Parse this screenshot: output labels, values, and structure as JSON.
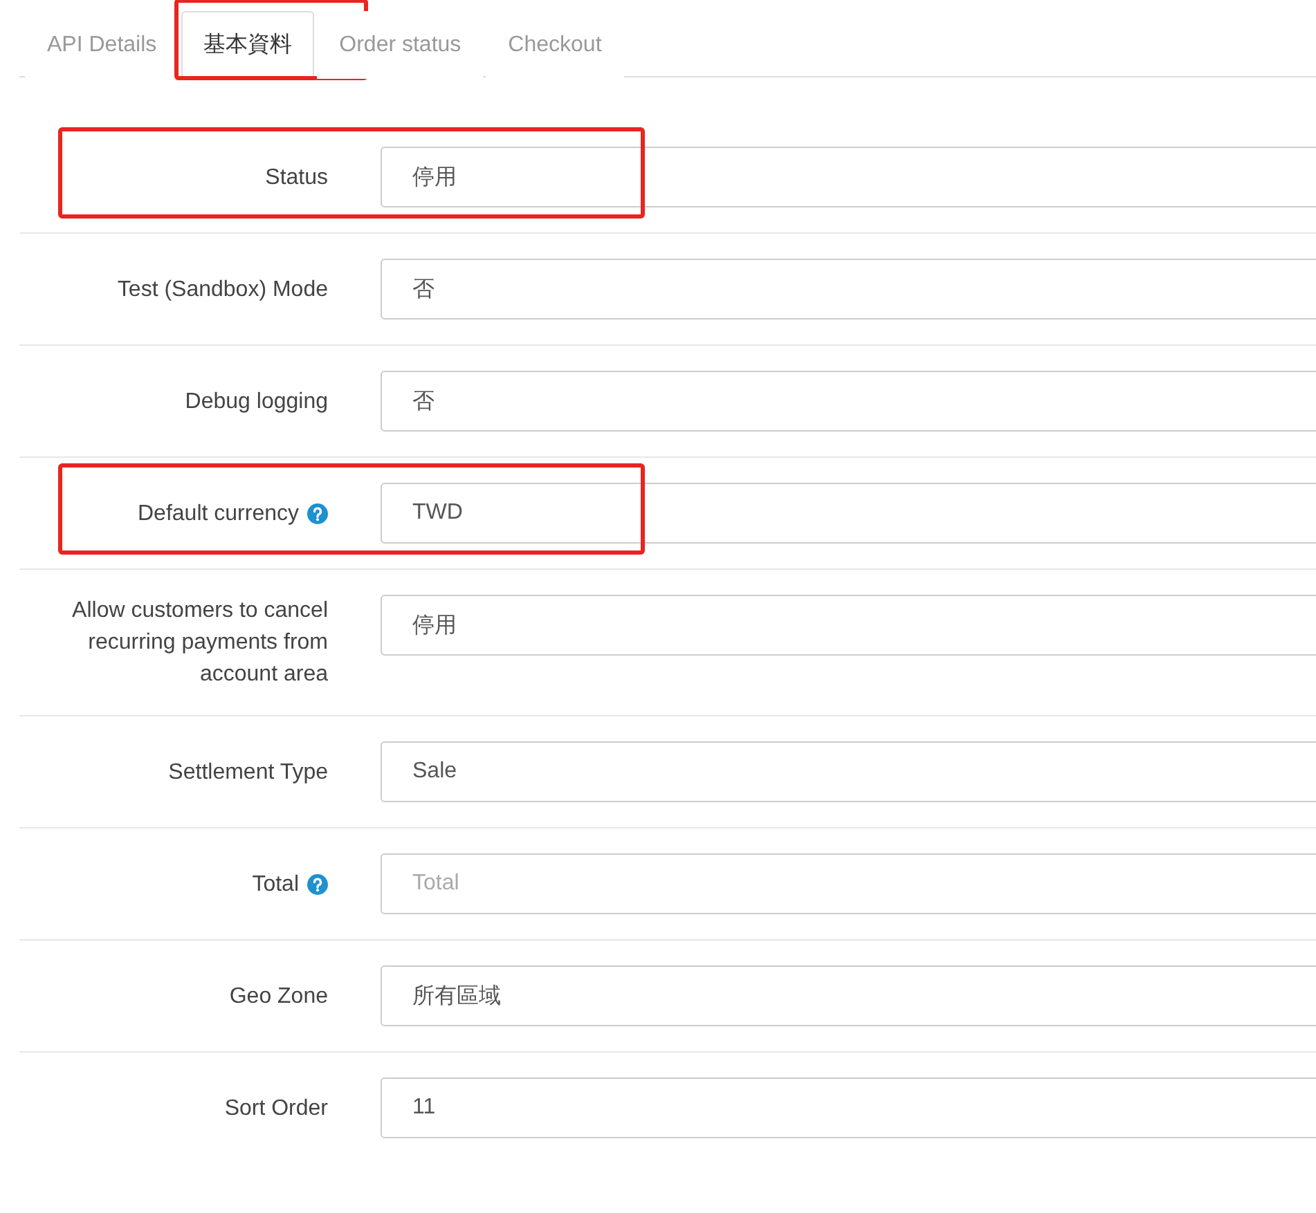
{
  "tabs": [
    {
      "label": "API Details",
      "selected": false,
      "highlighted": false
    },
    {
      "label": "基本資料",
      "selected": true,
      "highlighted": true
    },
    {
      "label": "Order status",
      "selected": false,
      "highlighted": false
    },
    {
      "label": "Checkout",
      "selected": false,
      "highlighted": false
    }
  ],
  "fields": [
    {
      "label": "Status",
      "value": "停用",
      "help": false,
      "highlighted": true
    },
    {
      "label": "Test (Sandbox) Mode",
      "value": "否",
      "help": false,
      "highlighted": false
    },
    {
      "label": "Debug logging",
      "value": "否",
      "help": false,
      "highlighted": false
    },
    {
      "label": "Default currency",
      "value": "TWD",
      "help": true,
      "highlighted": true
    },
    {
      "label": "Allow customers to cancel recurring payments from account area",
      "value": "停用",
      "help": false,
      "highlighted": false
    },
    {
      "label": "Settlement Type",
      "value": "Sale",
      "help": false,
      "highlighted": false
    },
    {
      "label": "Total",
      "placeholder": "Total",
      "help": true,
      "highlighted": false
    },
    {
      "label": "Geo Zone",
      "value": "所有區域",
      "help": false,
      "highlighted": false
    },
    {
      "label": "Sort Order",
      "value": "11",
      "help": false,
      "highlighted": false
    }
  ]
}
